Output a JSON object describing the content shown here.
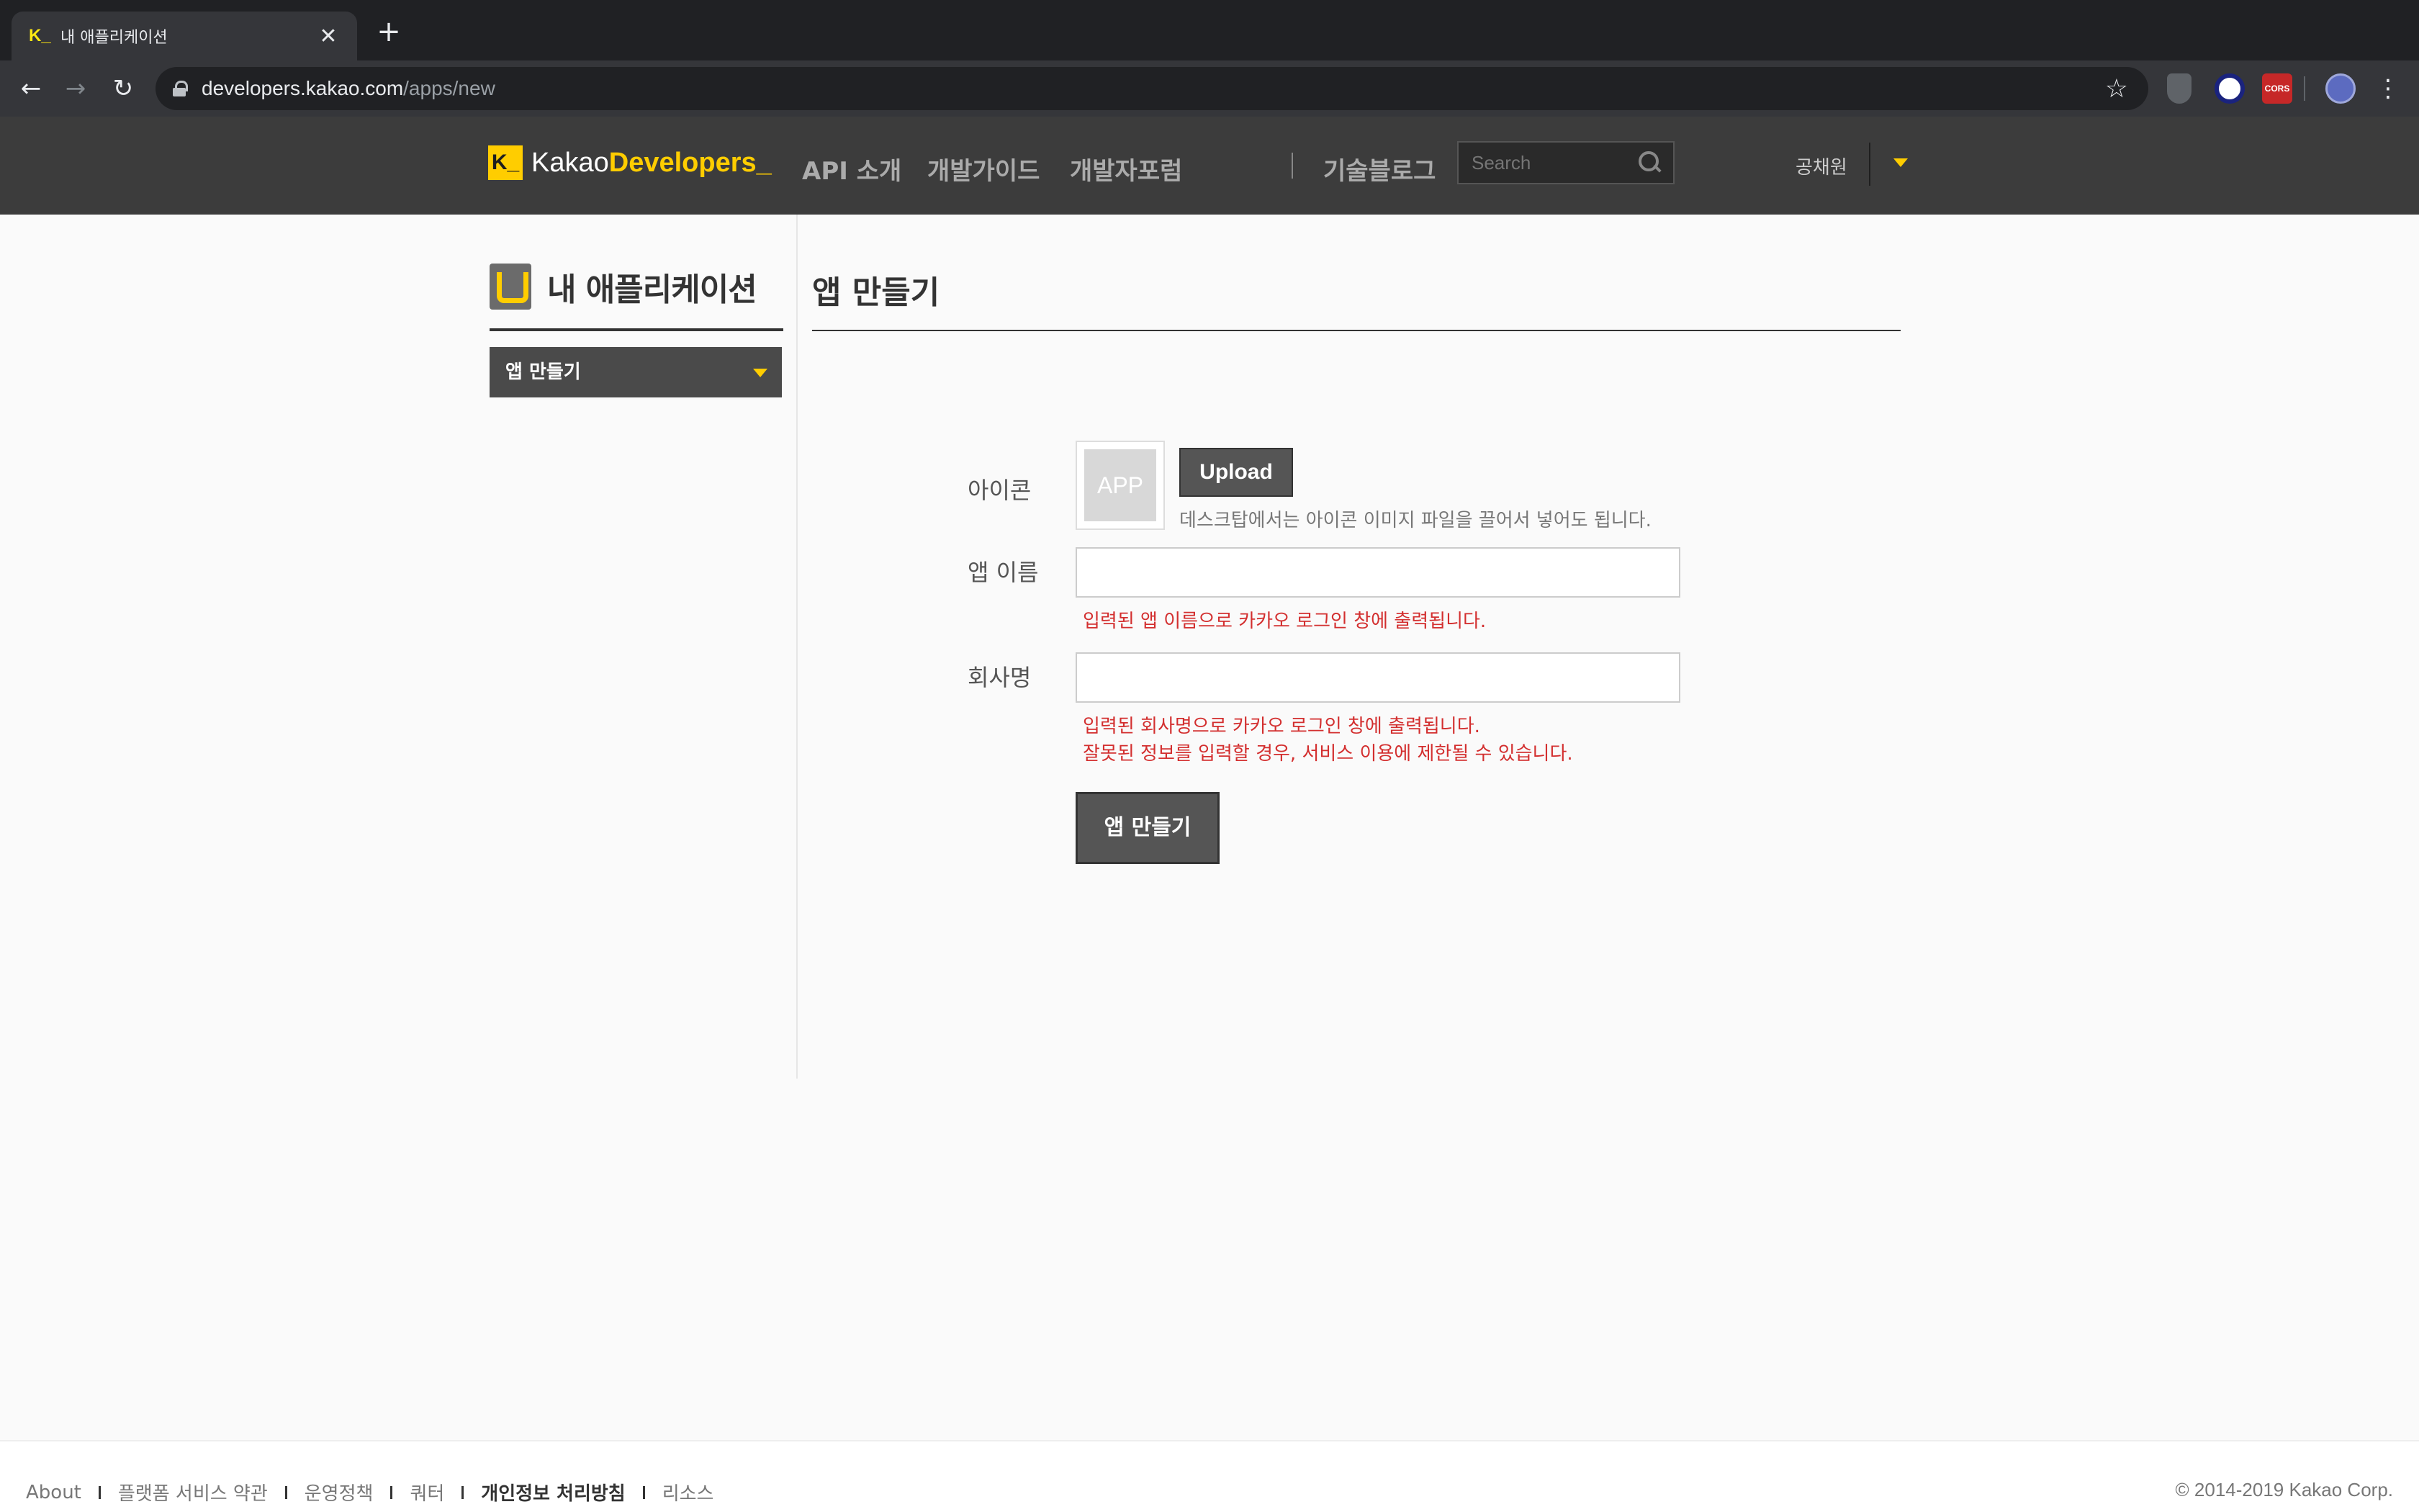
{
  "browser": {
    "tab_title": "내 애플리케이션",
    "tab_favicon": "K_",
    "url_host": "developers.kakao.com",
    "url_path": "/apps/new",
    "extension_cors_label": "CORS"
  },
  "header": {
    "logo_k": "K_",
    "logo_kakao": "Kakao",
    "logo_developers": "Developers_",
    "nav": [
      "API 소개",
      "개발가이드",
      "개발자포럼",
      "기술블로그"
    ],
    "search_placeholder": "Search",
    "user_name": "공채원",
    "accent_color": "#ffcd00"
  },
  "sidebar": {
    "title": "내 애플리케이션",
    "selected": "앱 만들기"
  },
  "main": {
    "title": "앱 만들기",
    "icon_label": "아이콘",
    "icon_placeholder": "APP",
    "upload_label": "Upload",
    "upload_hint": "데스크탑에서는 아이콘 이미지 파일을 끌어서 넣어도 됩니다.",
    "app_name_label": "앱 이름",
    "app_name_value": "",
    "app_name_error": "입력된 앱 이름으로 카카오 로그인 창에 출력됩니다.",
    "company_label": "회사명",
    "company_value": "",
    "company_error_1": "입력된 회사명으로 카카오 로그인 창에 출력됩니다.",
    "company_error_2": "잘못된 정보를 입력할 경우, 서비스 이용에 제한될 수 있습니다.",
    "submit_label": "앱 만들기",
    "error_color": "#d32f2f"
  },
  "footer": {
    "links": [
      "About",
      "플랫폼 서비스 약관",
      "운영정책",
      "쿼터",
      "개인정보 처리방침",
      "리소스"
    ],
    "copyright": "© 2014-2019 Kakao Corp."
  }
}
